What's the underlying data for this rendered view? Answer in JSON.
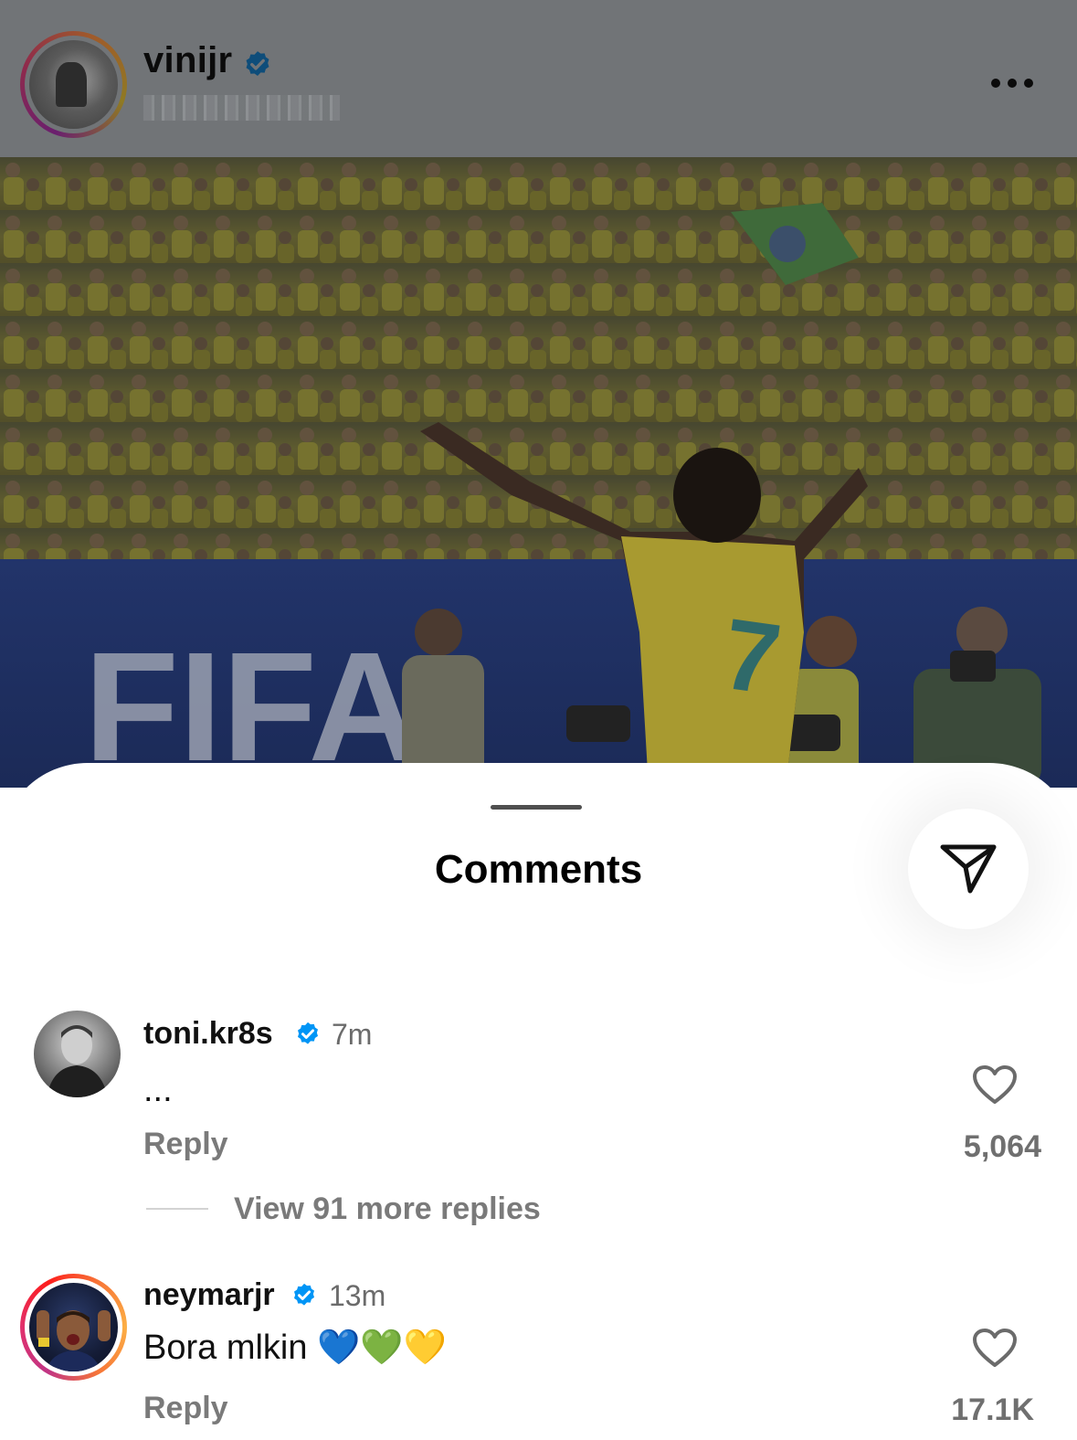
{
  "post": {
    "username": "vinijr",
    "verified": true,
    "more_icon": "more-horizontal-icon",
    "photo_banner_text": "FIFA"
  },
  "comments_sheet": {
    "title": "Comments",
    "share_icon": "send-icon"
  },
  "comments": [
    {
      "username": "toni.kr8s",
      "verified": true,
      "time": "7m",
      "text": "...",
      "reply_label": "Reply",
      "likes": "5,064",
      "view_replies": "View 91 more replies"
    },
    {
      "username": "neymarjr",
      "verified": true,
      "time": "13m",
      "text": "Bora mlkin 💙💚💛",
      "reply_label": "Reply",
      "likes": "17.1K"
    }
  ],
  "colors": {
    "verified_blue": "#0095f6",
    "dim_overlay": "#717477",
    "story_ring_start": "#c13584",
    "story_ring_end": "#fcaf45"
  }
}
